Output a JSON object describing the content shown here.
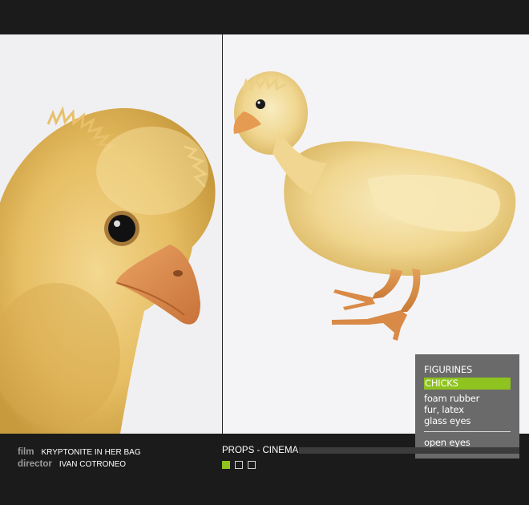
{
  "project": {
    "credits": [
      {
        "key": "film",
        "value": "KRYPTONITE IN HER BAG"
      },
      {
        "key": "director",
        "value": "IVAN COTRONEO"
      }
    ],
    "section_title": "PROPS - CINEMA",
    "progress_fraction": 0.0
  },
  "info_panel": {
    "category": "FIGURINES",
    "active_item": "CHICKS",
    "materials": [
      "foam rubber",
      "fur, latex",
      "glass eyes"
    ],
    "option": "open eyes"
  },
  "photos": [
    {
      "icon": "chick-closeup-photo"
    },
    {
      "icon": "chick-standing-photo"
    }
  ],
  "pager": {
    "pages": [
      {
        "label": "",
        "active": true
      },
      {
        "label": "",
        "active": false
      },
      {
        "label": "",
        "active": false
      }
    ]
  },
  "colors": {
    "accent": "#8fc31f",
    "background": "#1b1b1b",
    "panel": "#6a6a6a"
  }
}
